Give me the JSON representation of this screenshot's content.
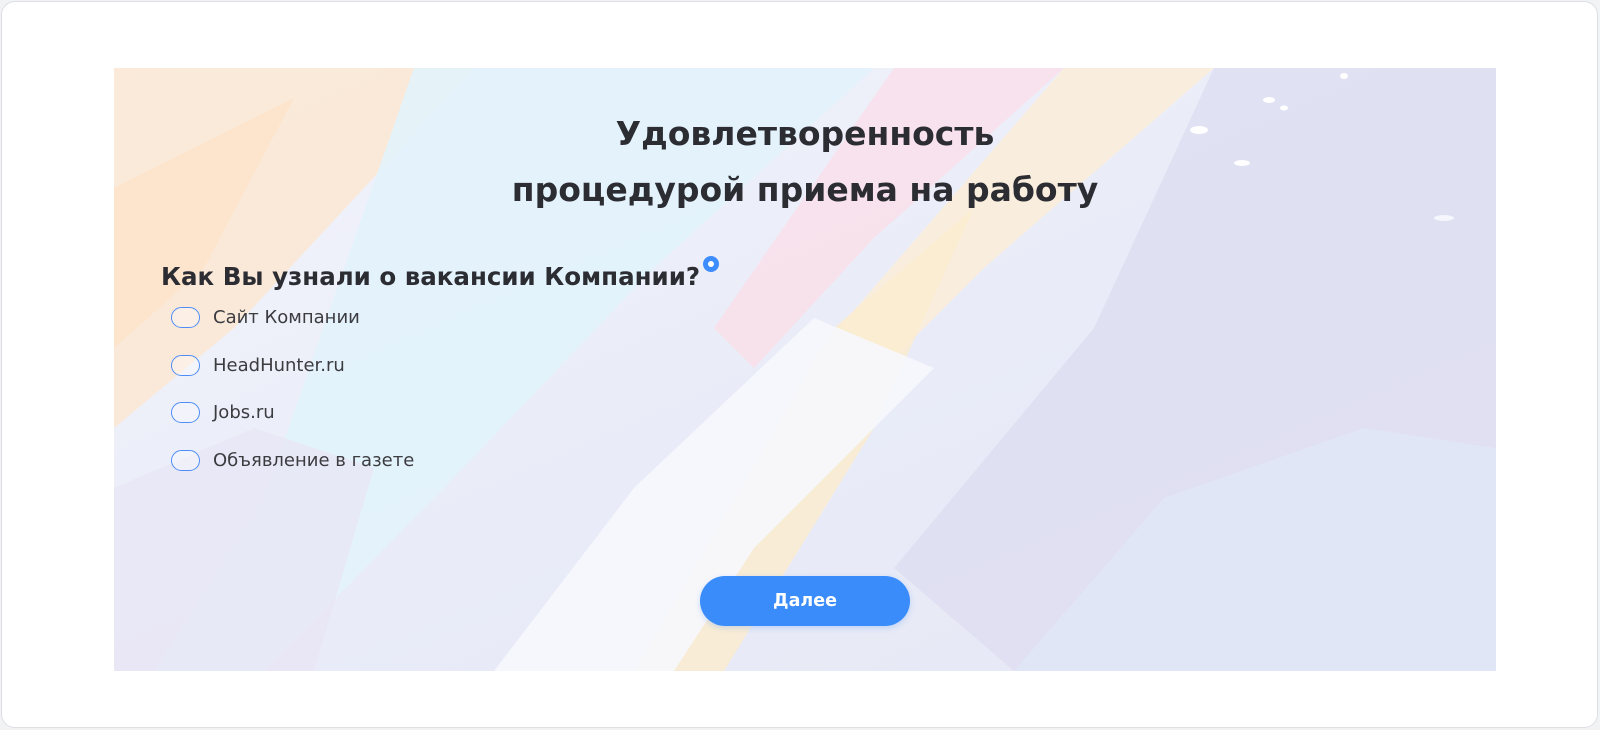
{
  "survey": {
    "title_line1": "Удовлетворенность",
    "title_line2": "процедурой приема на работу",
    "question": "Как Вы узнали о вакансии Компании?",
    "options": [
      {
        "label": "Сайт Компании",
        "selected": false
      },
      {
        "label": "HeadHunter.ru",
        "selected": false
      },
      {
        "label": "Jobs.ru",
        "selected": false
      },
      {
        "label": "Объявление в газете",
        "selected": false
      }
    ],
    "next_label": "Далее"
  },
  "colors": {
    "accent": "#3a8cfb",
    "text": "#2c2c33",
    "radio_border": "#4f8ef7"
  },
  "icons": {
    "required": "required-dot-icon"
  }
}
